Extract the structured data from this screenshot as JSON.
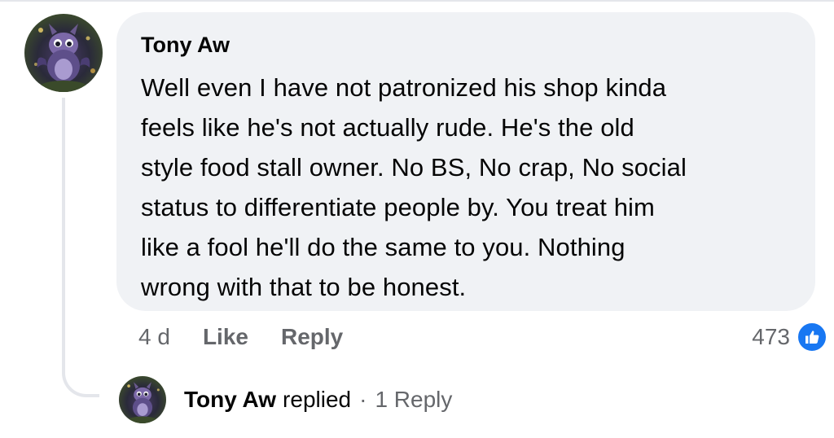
{
  "comment": {
    "author": "Tony Aw",
    "text": "Well even I have not patronized his shop kinda\nfeels like he's not actually rude. He's the old\nstyle food stall owner. No BS, No crap, No social\nstatus to differentiate people by. You treat him\nlike a fool he'll do the same to you. Nothing\nwrong with that to be honest.",
    "time": "4 d",
    "like_label": "Like",
    "reply_label": "Reply",
    "reaction_count": "473",
    "reaction_icon": "thumbs-up-icon",
    "reaction_color": "#1877f2"
  },
  "reply_summary": {
    "author": "Tony Aw",
    "verb": "replied",
    "separator": "·",
    "count_label": "1 Reply"
  },
  "colors": {
    "bubble_bg": "#f0f2f5",
    "secondary_text": "#65676b",
    "thread_line": "#e4e6eb"
  }
}
